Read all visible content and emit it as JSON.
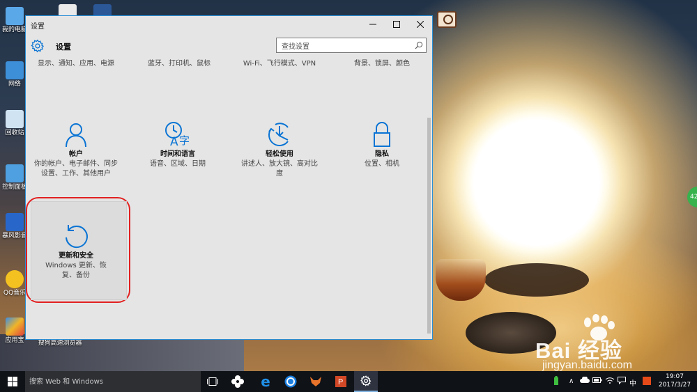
{
  "window": {
    "title": "设置",
    "header_title": "设置",
    "search_placeholder": "查找设置"
  },
  "top_row": [
    {
      "desc": "显示、通知、应用、电源"
    },
    {
      "desc": "蓝牙、打印机、鼠标"
    },
    {
      "desc": "Wi-Fi、飞行模式、VPN"
    },
    {
      "desc": "背景、锁屏、颜色"
    }
  ],
  "tiles": [
    {
      "title": "帐户",
      "desc": "你的帐户、电子邮件、同步设置、工作、其他用户",
      "icon": "person-icon"
    },
    {
      "title": "时间和语言",
      "desc": "语音、区域、日期",
      "icon": "time-language-icon"
    },
    {
      "title": "轻松使用",
      "desc": "讲述人、放大镜、高对比度",
      "icon": "ease-of-access-icon"
    },
    {
      "title": "隐私",
      "desc": "位置、相机",
      "icon": "lock-icon"
    },
    {
      "title": "更新和安全",
      "desc": "Windows 更新、恢复、备份",
      "icon": "update-icon"
    }
  ],
  "desktop_icons": [
    "我的电脑",
    "网络",
    "回收站",
    "控制面板",
    "暴风影音",
    "QQ音乐",
    "应用宝",
    "搜狗高速浏览器"
  ],
  "taskbar": {
    "search_placeholder": "搜索 Web 和 Windows",
    "ime": "中",
    "time": "19:07",
    "date": "2017/3/27"
  },
  "watermark": {
    "brand": "Bai  经验",
    "url": "jingyan.baidu.com"
  },
  "bubble_text": "42",
  "colors": {
    "accent": "#0a74d4",
    "highlight": "#e22020",
    "window_bg": "#e5e5e5"
  }
}
